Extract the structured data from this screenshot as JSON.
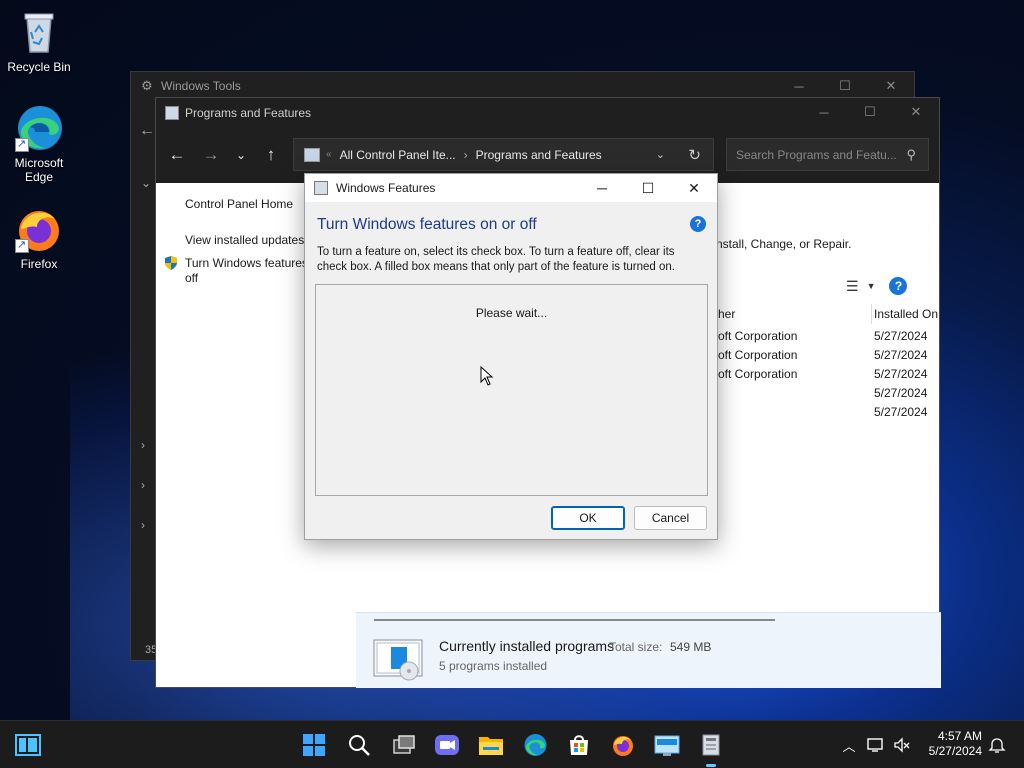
{
  "desktop": {
    "icons": [
      {
        "label": "Recycle Bin",
        "icon": "recycle-bin-icon"
      },
      {
        "label": "Microsoft Edge",
        "icon": "edge-icon"
      },
      {
        "label": "Firefox",
        "icon": "firefox-icon"
      }
    ]
  },
  "windows_tools": {
    "title": "Windows Tools",
    "side_text": "35"
  },
  "programs_features": {
    "title": "Programs and Features",
    "address": {
      "segment1": "All Control Panel Ite...",
      "separator": "›",
      "segment2": "Programs and Features"
    },
    "search_placeholder": "Search Programs and Featu...",
    "leftnav": {
      "home": "Control Panel Home",
      "updates": "View installed updates",
      "features_line1": "Turn Windows features on or",
      "features_line2": "off"
    },
    "uninstall_hint": "nstall, Change, or Repair.",
    "columns": {
      "publisher": "her",
      "installed_on": "Installed On"
    },
    "rows": [
      {
        "publisher": "oft Corporation",
        "date": "5/27/2024"
      },
      {
        "publisher": "oft Corporation",
        "date": "5/27/2024"
      },
      {
        "publisher": "oft Corporation",
        "date": "5/27/2024"
      },
      {
        "publisher": "",
        "date": "5/27/2024"
      },
      {
        "publisher": "",
        "date": "5/27/2024"
      }
    ],
    "status": {
      "title": "Currently installed programs",
      "total_size_label": "Total size:",
      "total_size_value": "549 MB",
      "count": "5 programs installed"
    }
  },
  "windows_features": {
    "title": "Windows Features",
    "heading": "Turn Windows features on or off",
    "description": "To turn a feature on, select its check box. To turn a feature off, clear its check box. A filled box means that only part of the feature is turned on.",
    "loading_text": "Please wait...",
    "ok_label": "OK",
    "cancel_label": "Cancel"
  },
  "taskbar": {
    "time": "4:57 AM",
    "date": "5/27/2024"
  },
  "colors": {
    "accent": "#0063b1",
    "heading_blue": "#1e3a8c",
    "help_blue": "#1a73d9",
    "dark_chrome": "#1f1f1f"
  }
}
